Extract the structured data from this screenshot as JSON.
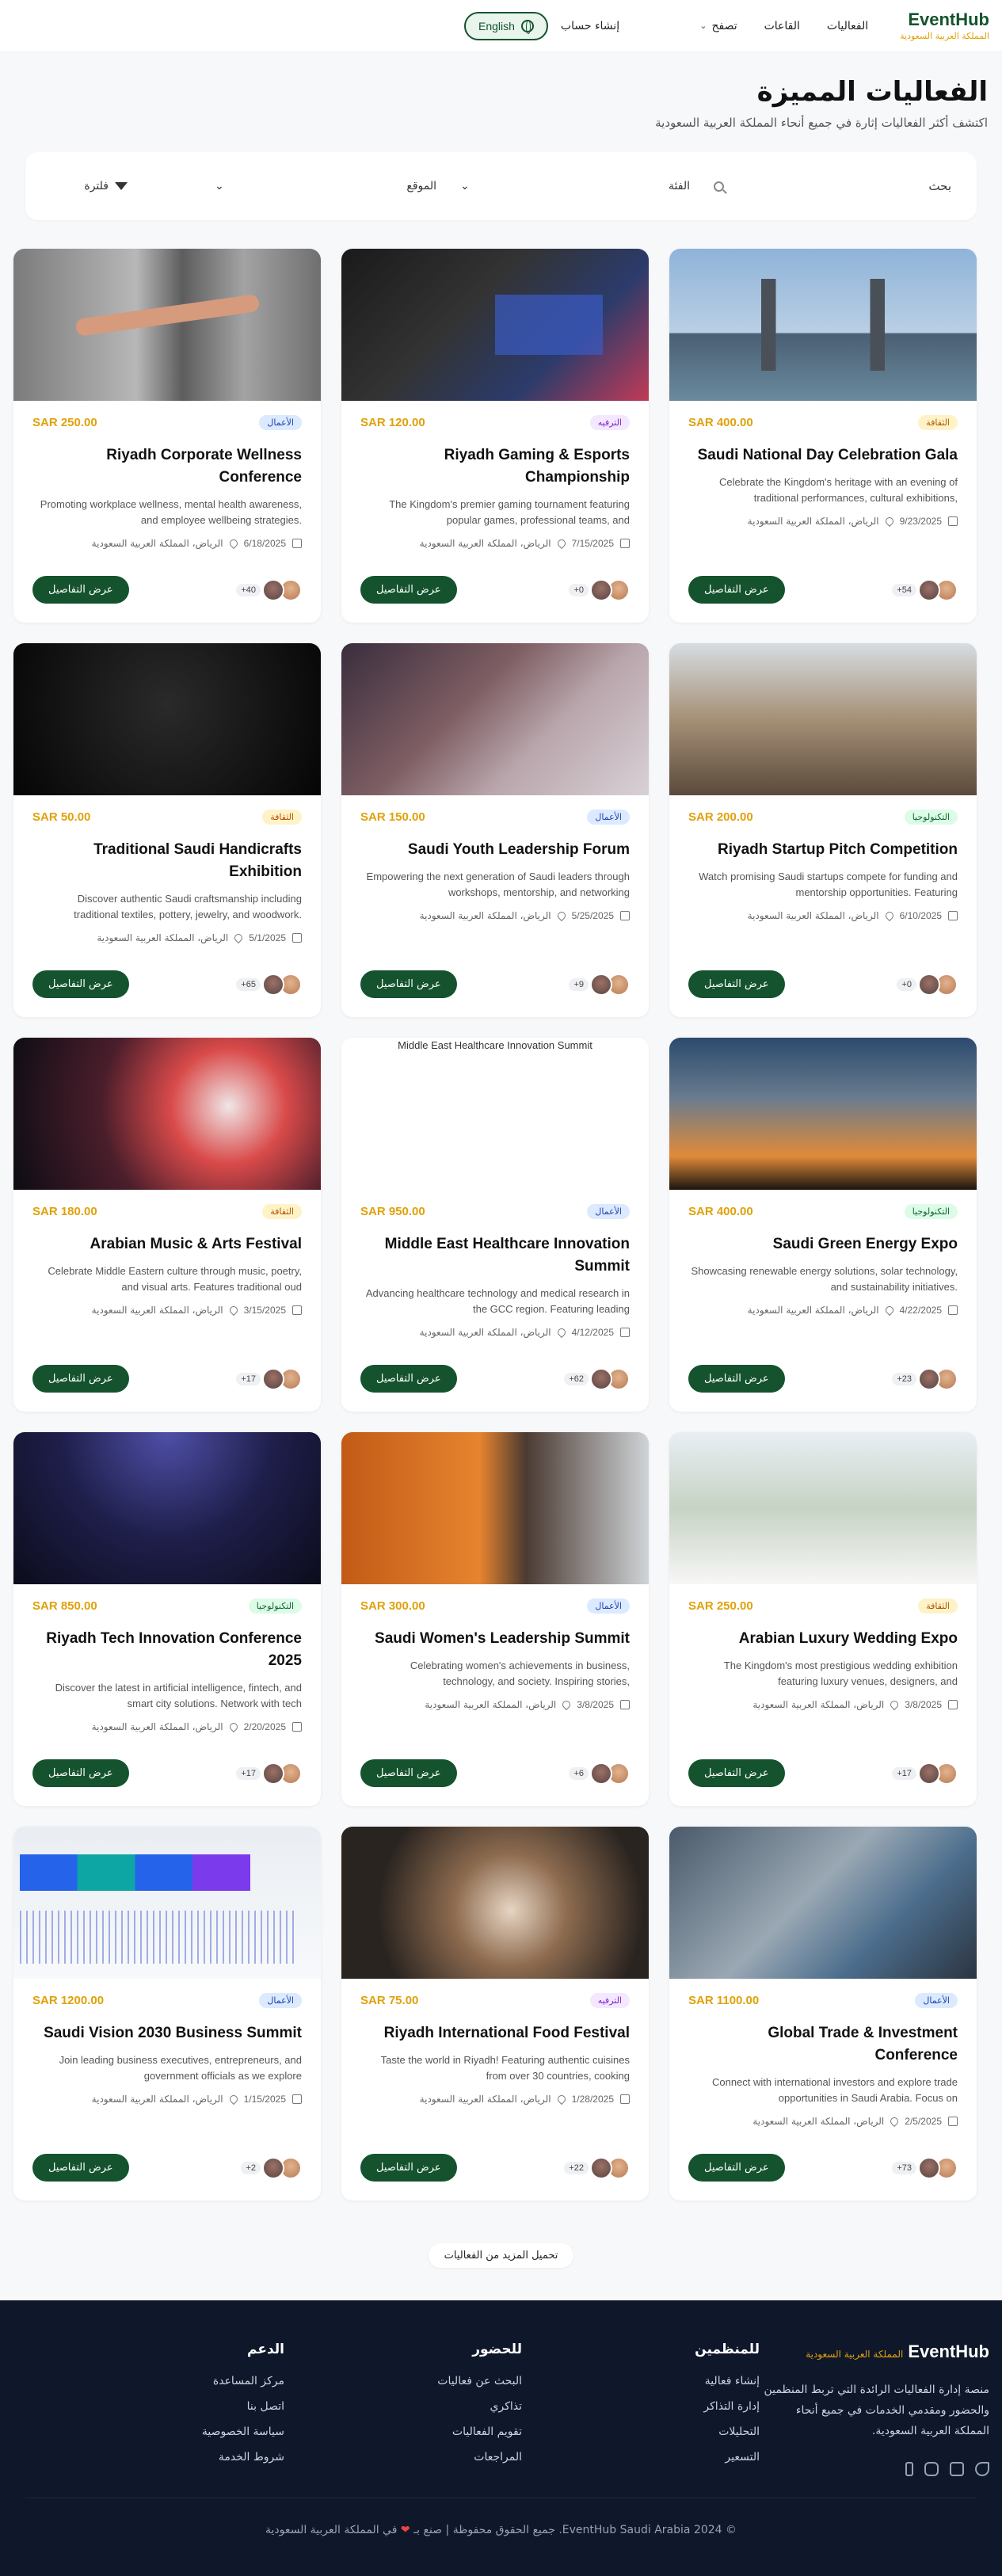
{
  "header": {
    "brand_name": "EventHub",
    "brand_sub": "المملكة العربية السعودية",
    "nav": {
      "events": "الفعاليات",
      "venues": "القاعات",
      "browse": "تصفح"
    },
    "create_account": "إنشاء حساب",
    "language": "English"
  },
  "hero": {
    "title": "الفعاليات المميزة",
    "subtitle": "اكتشف أكثر الفعاليات إثارة في جميع أنحاء المملكة العربية السعودية"
  },
  "filters": {
    "search": "بحث",
    "category": "الفئة",
    "location": "الموقع",
    "filter": "فلترة"
  },
  "common": {
    "details_button": "عرض التفاصيل",
    "location": "الرياض، المملكة العربية السعودية"
  },
  "events": [
    {
      "title": "Saudi National Day Celebration Gala",
      "category": "الثقافة",
      "category_type": "culture",
      "price": "SAR 400.00",
      "desc": "Celebrate the Kingdom's heritage with an evening of traditional performances, cultural exhibitions,",
      "date": "9/23/2025",
      "attendees": "+54",
      "image": "bridge"
    },
    {
      "title": "Riyadh Gaming & Esports Championship",
      "category": "الترفيه",
      "category_type": "entertainment",
      "price": "SAR 120.00",
      "desc": "The Kingdom's premier gaming tournament featuring popular games, professional teams, and",
      "date": "7/15/2025",
      "attendees": "+0",
      "image": "gaming"
    },
    {
      "title": "Riyadh Corporate Wellness Conference",
      "category": "الأعمال",
      "category_type": "business",
      "price": "SAR 250.00",
      "desc": "Promoting workplace wellness, mental health awareness, and employee wellbeing strategies.",
      "date": "6/18/2025",
      "attendees": "+40",
      "image": "hands"
    },
    {
      "title": "Riyadh Startup Pitch Competition",
      "category": "التكنولوجيا",
      "category_type": "technology",
      "price": "SAR 200.00",
      "desc": "Watch promising Saudi startups compete for funding and mentorship opportunities. Featuring",
      "date": "6/10/2025",
      "attendees": "+0",
      "image": "office"
    },
    {
      "title": "Saudi Youth Leadership Forum",
      "category": "الأعمال",
      "category_type": "business",
      "price": "SAR 150.00",
      "desc": "Empowering the next generation of Saudi leaders through workshops, mentorship, and networking",
      "date": "5/25/2025",
      "attendees": "+9",
      "image": "laptop"
    },
    {
      "title": "Traditional Saudi Handicrafts Exhibition",
      "category": "الثقافة",
      "category_type": "culture",
      "price": "SAR 50.00",
      "desc": "Discover authentic Saudi craftsmanship including traditional textiles, pottery, jewelry, and woodwork.",
      "date": "5/1/2025",
      "attendees": "+65",
      "image": "dark"
    },
    {
      "title": "Saudi Green Energy Expo",
      "category": "التكنولوجيا",
      "category_type": "technology",
      "price": "SAR 400.00",
      "desc": "Showcasing renewable energy solutions, solar technology, and sustainability initiatives.",
      "date": "4/22/2025",
      "attendees": "+23",
      "image": "sunset"
    },
    {
      "title": "Middle East Healthcare Innovation Summit",
      "category": "الأعمال",
      "category_type": "business",
      "price": "SAR 950.00",
      "desc": "Advancing healthcare technology and medical research in the GCC region. Featuring leading",
      "date": "4/12/2025",
      "attendees": "+62",
      "image": "blank",
      "image_alt": "Middle East Healthcare Innovation Summit"
    },
    {
      "title": "Arabian Music & Arts Festival",
      "category": "الثقافة",
      "category_type": "culture",
      "price": "SAR 180.00",
      "desc": "Celebrate Middle Eastern culture through music, poetry, and visual arts. Features traditional oud",
      "date": "3/15/2025",
      "attendees": "+17",
      "image": "concert"
    },
    {
      "title": "Arabian Luxury Wedding Expo",
      "category": "الثقافة",
      "category_type": "culture",
      "price": "SAR 250.00",
      "desc": "The Kingdom's most prestigious wedding exhibition featuring luxury venues, designers, and",
      "date": "3/8/2025",
      "attendees": "+17",
      "image": "wedding"
    },
    {
      "title": "Saudi Women's Leadership Summit",
      "category": "الأعمال",
      "category_type": "business",
      "price": "SAR 300.00",
      "desc": "Celebrating women's achievements in business, technology, and society. Inspiring stories,",
      "date": "3/8/2025",
      "attendees": "+6",
      "image": "woman"
    },
    {
      "title": "Riyadh Tech Innovation Conference 2025",
      "category": "التكنولوجيا",
      "category_type": "technology",
      "price": "SAR 850.00",
      "desc": "Discover the latest in artificial intelligence, fintech, and smart city solutions. Network with tech",
      "date": "2/20/2025",
      "attendees": "+17",
      "image": "audience"
    },
    {
      "title": "Global Trade & Investment Conference",
      "category": "الأعمال",
      "category_type": "business",
      "price": "SAR 1100.00",
      "desc": "Connect with international investors and explore trade opportunities in Saudi Arabia. Focus on",
      "date": "2/5/2025",
      "attendees": "+73",
      "image": "meeting"
    },
    {
      "title": "Riyadh International Food Festival",
      "category": "الترفيه",
      "category_type": "entertainment",
      "price": "SAR 75.00",
      "desc": "Taste the world in Riyadh! Featuring authentic cuisines from over 30 countries, cooking",
      "date": "1/28/2025",
      "attendees": "+22",
      "image": "food"
    },
    {
      "title": "Saudi Vision 2030 Business Summit",
      "category": "الأعمال",
      "category_type": "business",
      "price": "SAR 1200.00",
      "desc": "Join leading business executives, entrepreneurs, and government officials as we explore",
      "date": "1/15/2025",
      "attendees": "+2",
      "image": "dashboard"
    }
  ],
  "load_more": "تحميل المزيد من الفعاليات",
  "footer": {
    "brand_name": "EventHub",
    "brand_sub": "المملكة العربية السعودية",
    "about": "منصة إدارة الفعاليات الرائدة التي تربط المنظمين والحضور ومقدمي الخدمات في جميع أنحاء المملكة العربية السعودية.",
    "organizers": {
      "title": "للمنظمين",
      "links": [
        "إنشاء فعالية",
        "إدارة التذاكر",
        "التحليلات",
        "التسعير"
      ]
    },
    "attendees": {
      "title": "للحضور",
      "links": [
        "البحث عن فعاليات",
        "تذاكري",
        "تقويم الفعاليات",
        "المراجعات"
      ]
    },
    "support": {
      "title": "الدعم",
      "links": [
        "مركز المساعدة",
        "اتصل بنا",
        "سياسة الخصوصية",
        "شروط الخدمة"
      ]
    },
    "copyright_pre": "© 2024 EventHub Saudi Arabia. جميع الحقوق محفوظة | صنع بـ",
    "copyright_post": "في المملكة العربية السعودية"
  }
}
